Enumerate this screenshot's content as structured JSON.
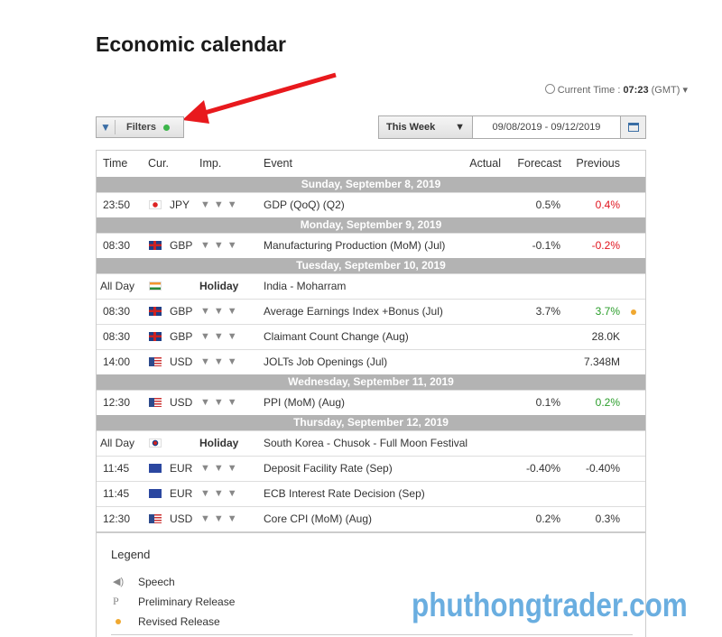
{
  "title": "Economic calendar",
  "current_time": {
    "label": "Current Time :",
    "time": "07:23",
    "zone": "(GMT)"
  },
  "filters": {
    "label": "Filters",
    "active_color": "#3cb54a"
  },
  "period": {
    "selected": "This Week",
    "range": "09/08/2019 - 09/12/2019"
  },
  "columns": {
    "time": "Time",
    "cur": "Cur.",
    "imp": "Imp.",
    "event": "Event",
    "actual": "Actual",
    "forecast": "Forecast",
    "previous": "Previous"
  },
  "rows": [
    {
      "day": "Sunday, September 8, 2019"
    },
    {
      "time": "23:50",
      "flag": "jp",
      "cur": "JPY",
      "imp": "bulls-3",
      "event": "GDP (QoQ) (Q2)",
      "actual": "",
      "forecast": "0.5%",
      "previous": "0.4%",
      "prev_color": "red"
    },
    {
      "day": "Monday, September 9, 2019"
    },
    {
      "time": "08:30",
      "flag": "gb",
      "cur": "GBP",
      "imp": "bulls-3",
      "event": "Manufacturing Production (MoM) (Jul)",
      "actual": "",
      "forecast": "-0.1%",
      "previous": "-0.2%",
      "prev_color": "red"
    },
    {
      "day": "Tuesday, September 10, 2019"
    },
    {
      "time": "All Day",
      "flag": "in",
      "cur": "",
      "imp": "Holiday",
      "event": "India - Moharram",
      "actual": "",
      "forecast": "",
      "previous": ""
    },
    {
      "time": "08:30",
      "flag": "gb",
      "cur": "GBP",
      "imp": "bulls-3",
      "event": "Average Earnings Index +Bonus (Jul)",
      "actual": "",
      "forecast": "3.7%",
      "previous": "3.7%",
      "prev_color": "green",
      "revised": true
    },
    {
      "time": "08:30",
      "flag": "gb",
      "cur": "GBP",
      "imp": "bulls-3",
      "event": "Claimant Count Change (Aug)",
      "actual": "",
      "forecast": "",
      "previous": "28.0K"
    },
    {
      "time": "14:00",
      "flag": "us",
      "cur": "USD",
      "imp": "bulls-3",
      "event": "JOLTs Job Openings (Jul)",
      "actual": "",
      "forecast": "",
      "previous": "7.348M"
    },
    {
      "day": "Wednesday, September 11, 2019"
    },
    {
      "time": "12:30",
      "flag": "us",
      "cur": "USD",
      "imp": "bulls-3",
      "event": "PPI (MoM) (Aug)",
      "actual": "",
      "forecast": "0.1%",
      "previous": "0.2%",
      "prev_color": "green"
    },
    {
      "day": "Thursday, September 12, 2019"
    },
    {
      "time": "All Day",
      "flag": "kr",
      "cur": "",
      "imp": "Holiday",
      "event": "South Korea - Chusok - Full Moon Festival",
      "actual": "",
      "forecast": "",
      "previous": ""
    },
    {
      "time": "11:45",
      "flag": "eu",
      "cur": "EUR",
      "imp": "bulls-3",
      "event": "Deposit Facility Rate (Sep)",
      "actual": "",
      "forecast": "-0.40%",
      "previous": "-0.40%"
    },
    {
      "time": "11:45",
      "flag": "eu",
      "cur": "EUR",
      "imp": "bulls-3",
      "event": "ECB Interest Rate Decision (Sep)",
      "actual": "",
      "forecast": "",
      "previous": ""
    },
    {
      "time": "12:30",
      "flag": "us",
      "cur": "USD",
      "imp": "bulls-3",
      "event": "Core CPI (MoM) (Aug)",
      "actual": "",
      "forecast": "0.2%",
      "previous": "0.3%"
    }
  ],
  "legend": {
    "title": "Legend",
    "items": [
      {
        "icon": "speech-icon",
        "label": "Speech"
      },
      {
        "icon": "preliminary-icon",
        "label": "Preliminary Release"
      },
      {
        "icon": "revised-dot-icon",
        "label": "Revised Release"
      }
    ]
  },
  "watermark": "phuthongtrader.com"
}
